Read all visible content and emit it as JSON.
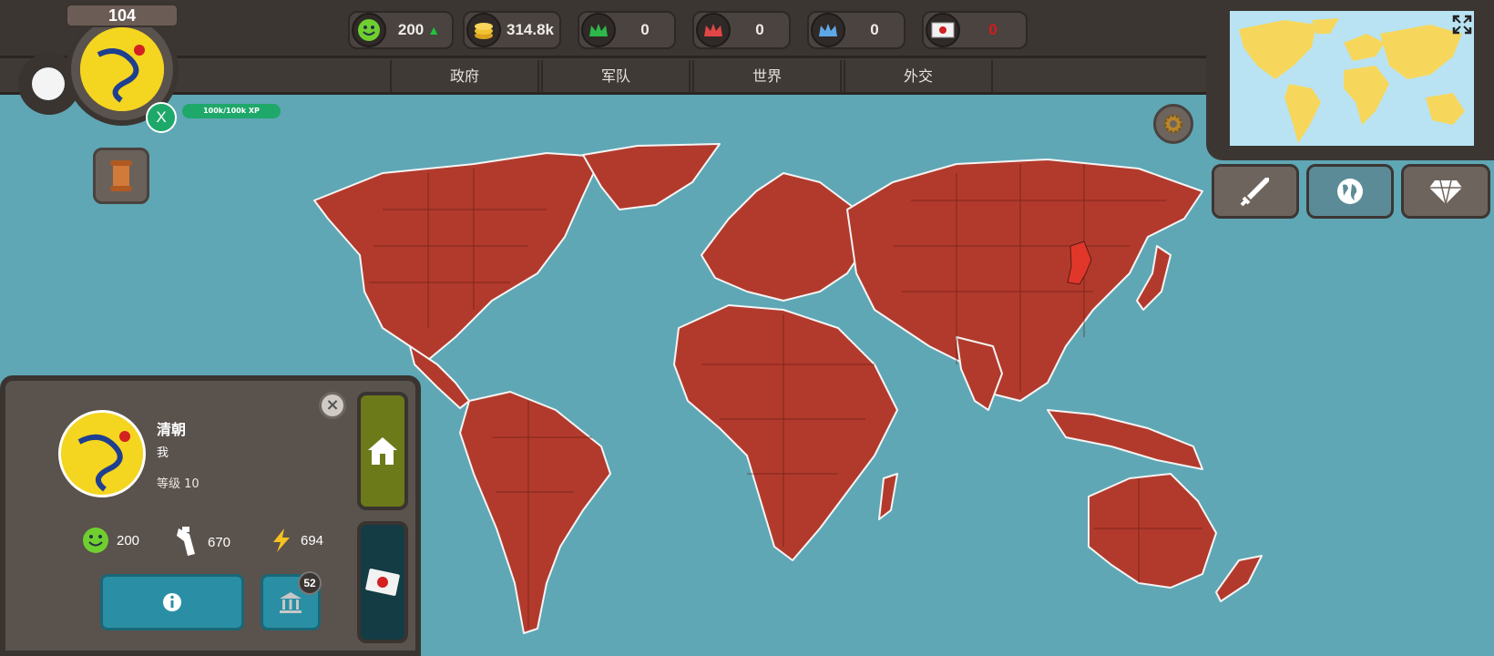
{
  "header": {
    "level": "104",
    "xp_label": "100k/100k XP",
    "xp_button": "X",
    "resources": [
      {
        "name": "happiness",
        "icon": "smiley-icon",
        "value": "200",
        "trend": "up"
      },
      {
        "name": "gold",
        "icon": "coins-icon",
        "value": "314.8k"
      },
      {
        "name": "green-crown",
        "icon": "crown-icon",
        "value": "0"
      },
      {
        "name": "red-crown",
        "icon": "crown-icon",
        "value": "0"
      },
      {
        "name": "blue-crown",
        "icon": "crown-icon",
        "value": "0"
      },
      {
        "name": "letters",
        "icon": "letter-icon",
        "value": "0"
      }
    ]
  },
  "nav": {
    "tabs": [
      {
        "label": "政府"
      },
      {
        "label": "军队"
      },
      {
        "label": "世界"
      },
      {
        "label": "外交"
      }
    ]
  },
  "side_buttons": [
    {
      "icon": "sword-icon"
    },
    {
      "icon": "globe-icon"
    },
    {
      "icon": "diamond-icon"
    }
  ],
  "country_panel": {
    "name": "清朝",
    "owner": "我",
    "level": "等级 10",
    "stats": [
      {
        "icon": "smiley-icon",
        "value": "200"
      },
      {
        "icon": "soldier-icon",
        "value": "670"
      },
      {
        "icon": "lightning-icon",
        "value": "694"
      }
    ],
    "bank_badge": "52"
  },
  "colors": {
    "ocean": "#5fa7b5",
    "land": "#b23a2c",
    "selected": "#e0372a",
    "topbar": "#3c3633",
    "xp_green": "#1ea86a",
    "minimap_land": "#f6d75c"
  }
}
